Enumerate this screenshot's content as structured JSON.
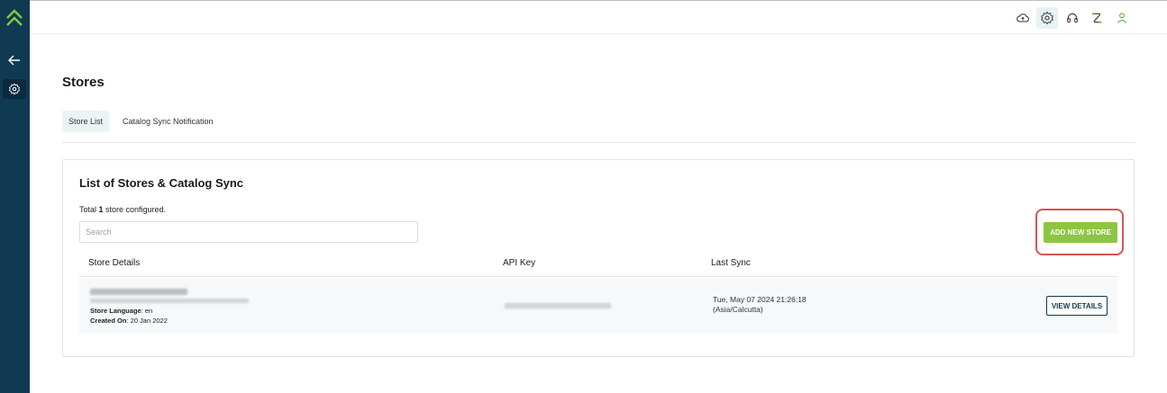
{
  "header": {
    "icons": [
      "cloud-icon",
      "gear-icon",
      "headset-icon",
      "route-icon",
      "user-icon"
    ]
  },
  "sidebar": {
    "icons": [
      "logo-icon",
      "back-arrow-icon",
      "settings-icon"
    ]
  },
  "page": {
    "title": "Stores"
  },
  "tabs": [
    {
      "label": "Store List",
      "active": true
    },
    {
      "label": "Catalog Sync Notification",
      "active": false
    }
  ],
  "card": {
    "title": "List of Stores & Catalog Sync",
    "total_prefix": "Total ",
    "total_count": "1",
    "total_suffix": " store configured.",
    "search_placeholder": "Search",
    "add_button": "ADD NEW STORE",
    "columns": [
      "Store Details",
      "API Key",
      "Last Sync"
    ],
    "rows": [
      {
        "store_language_label": "Store Language",
        "store_language": ": en",
        "created_on_label": "Created On",
        "created_on": ": 20 Jan 2022",
        "last_sync_line1": "Tue, May 07 2024 21:26:18",
        "last_sync_line2": "(Asia/Calcutta)",
        "action": "VIEW DETAILS"
      }
    ]
  },
  "colors": {
    "sidebar": "#0f3a52",
    "accent_green": "#8cc63f",
    "highlight_red": "#d9534f"
  }
}
